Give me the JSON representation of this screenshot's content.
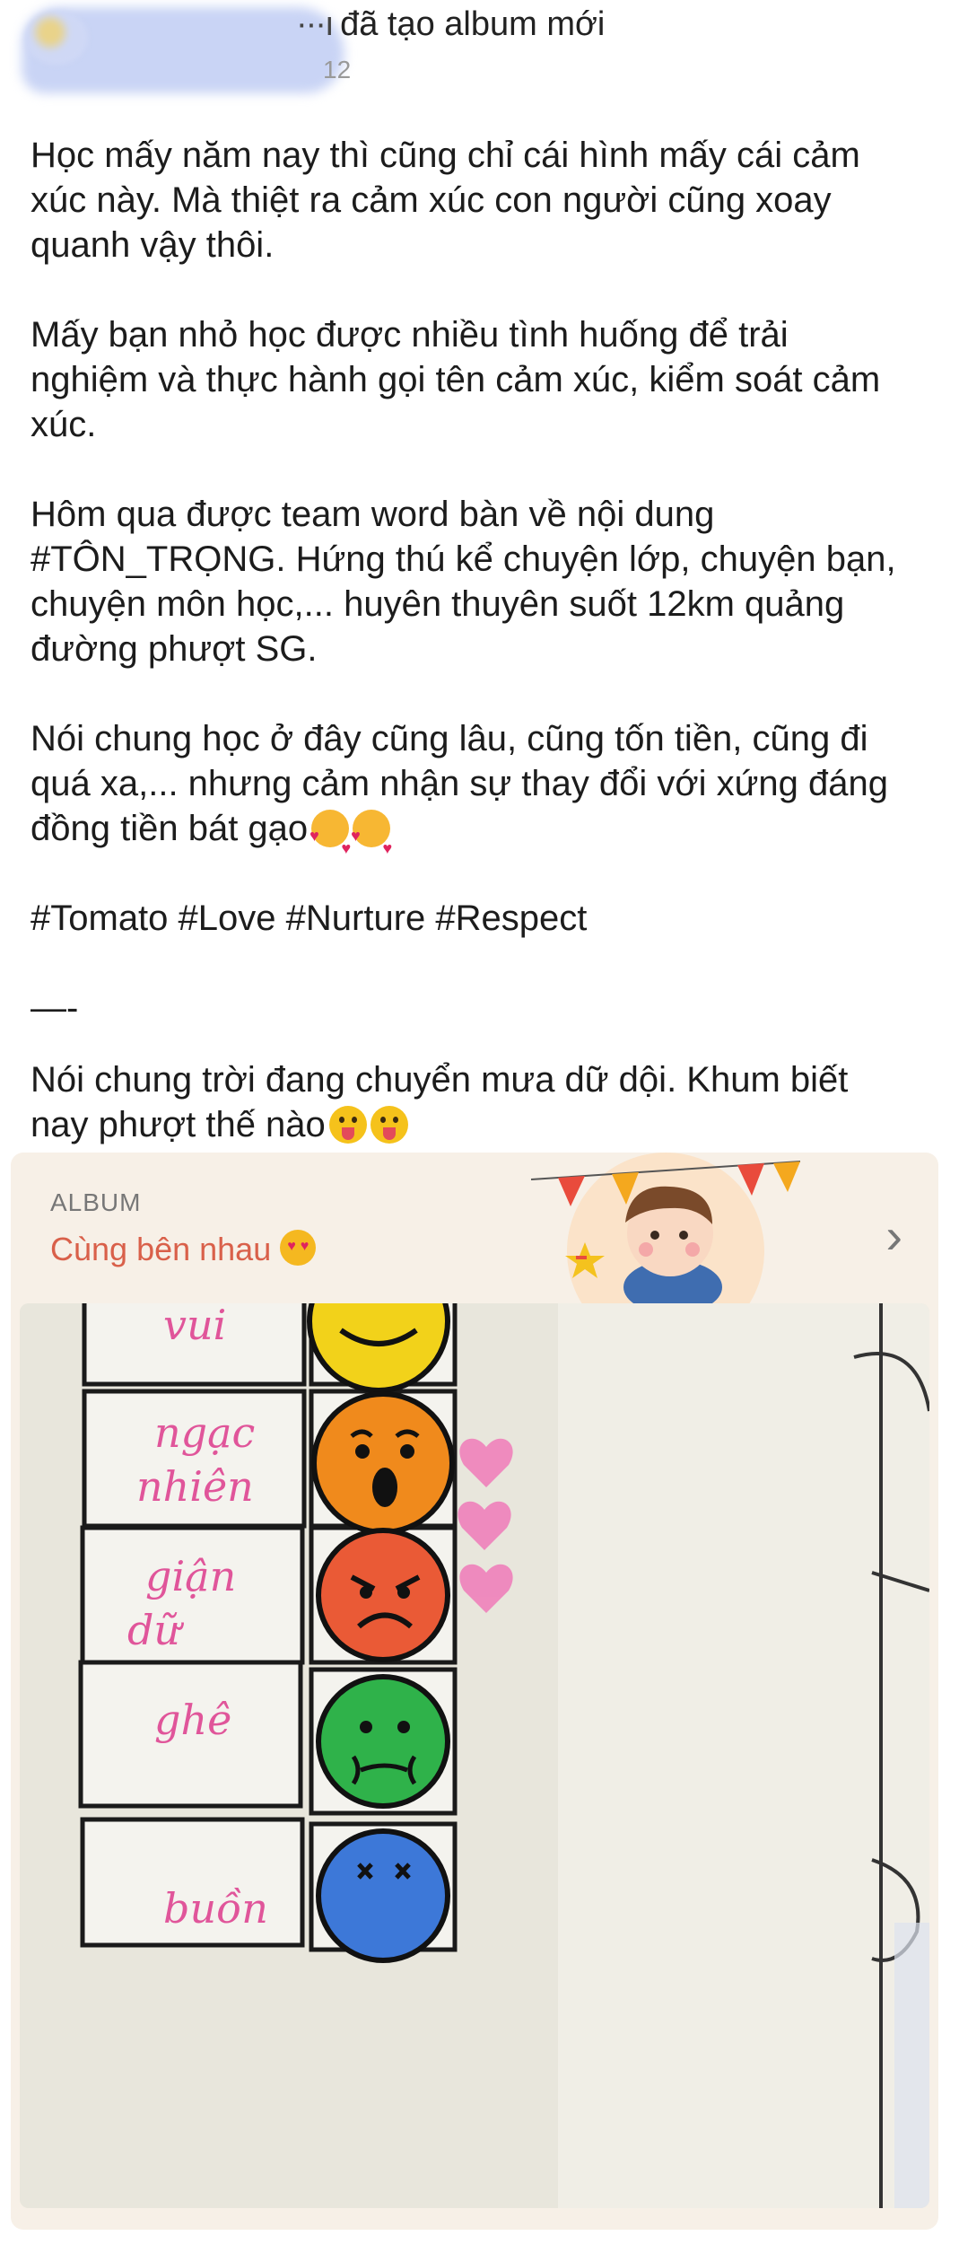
{
  "header": {
    "action": "đã tạo album mới",
    "time": "12"
  },
  "post": {
    "paragraphs": [
      "Học mấy năm nay thì cũng chỉ cái hình mấy cái cảm\nxúc này. Mà thiệt ra cảm xúc con người cũng xoay\nquanh vậy thôi.",
      "Mấy bạn nhỏ học được nhiều tình huống để trải\nnghiệm và thực hành gọi tên cảm xúc, kiểm soát cảm\nxúc.",
      "Hôm qua được team word bàn về nội dung\n#TÔN_TRỌNG. Hứng thú kể chuyện lớp, chuyện bạn,\nchuyện môn học,... huyên thuyên suốt 12km quảng\nđường phượt SG.",
      "Nói chung học ở đây cũng lâu, cũng tốn tiền, cũng đi\nquá xa,... nhưng cảm nhận sự thay đổi với xứng đáng\nđồng tiền bát gạo",
      "#Tomato #Love #Nurture #Respect",
      "—-",
      "Nói chung trời đang chuyển mưa dữ dội. Khum biết\nnay phượt thế nào"
    ]
  },
  "album": {
    "label": "ALBUM",
    "title": "Cùng bên nhau",
    "rows": [
      {
        "word": "vui",
        "color": "#f2d21a",
        "face": "happy"
      },
      {
        "word": "ngạc nhiên",
        "color": "#f08a1c",
        "face": "surprised"
      },
      {
        "word": "giận dữ",
        "color": "#ea5a36",
        "face": "angry"
      },
      {
        "word": "ghê",
        "color": "#2fb24a",
        "face": "disgust"
      },
      {
        "word": "buồn",
        "color": "#3d78d8",
        "face": "sad"
      }
    ]
  },
  "colors": {
    "accent": "#d9604a",
    "card_bg": "#f7f0e7",
    "marker_pink": "#e0559a"
  }
}
